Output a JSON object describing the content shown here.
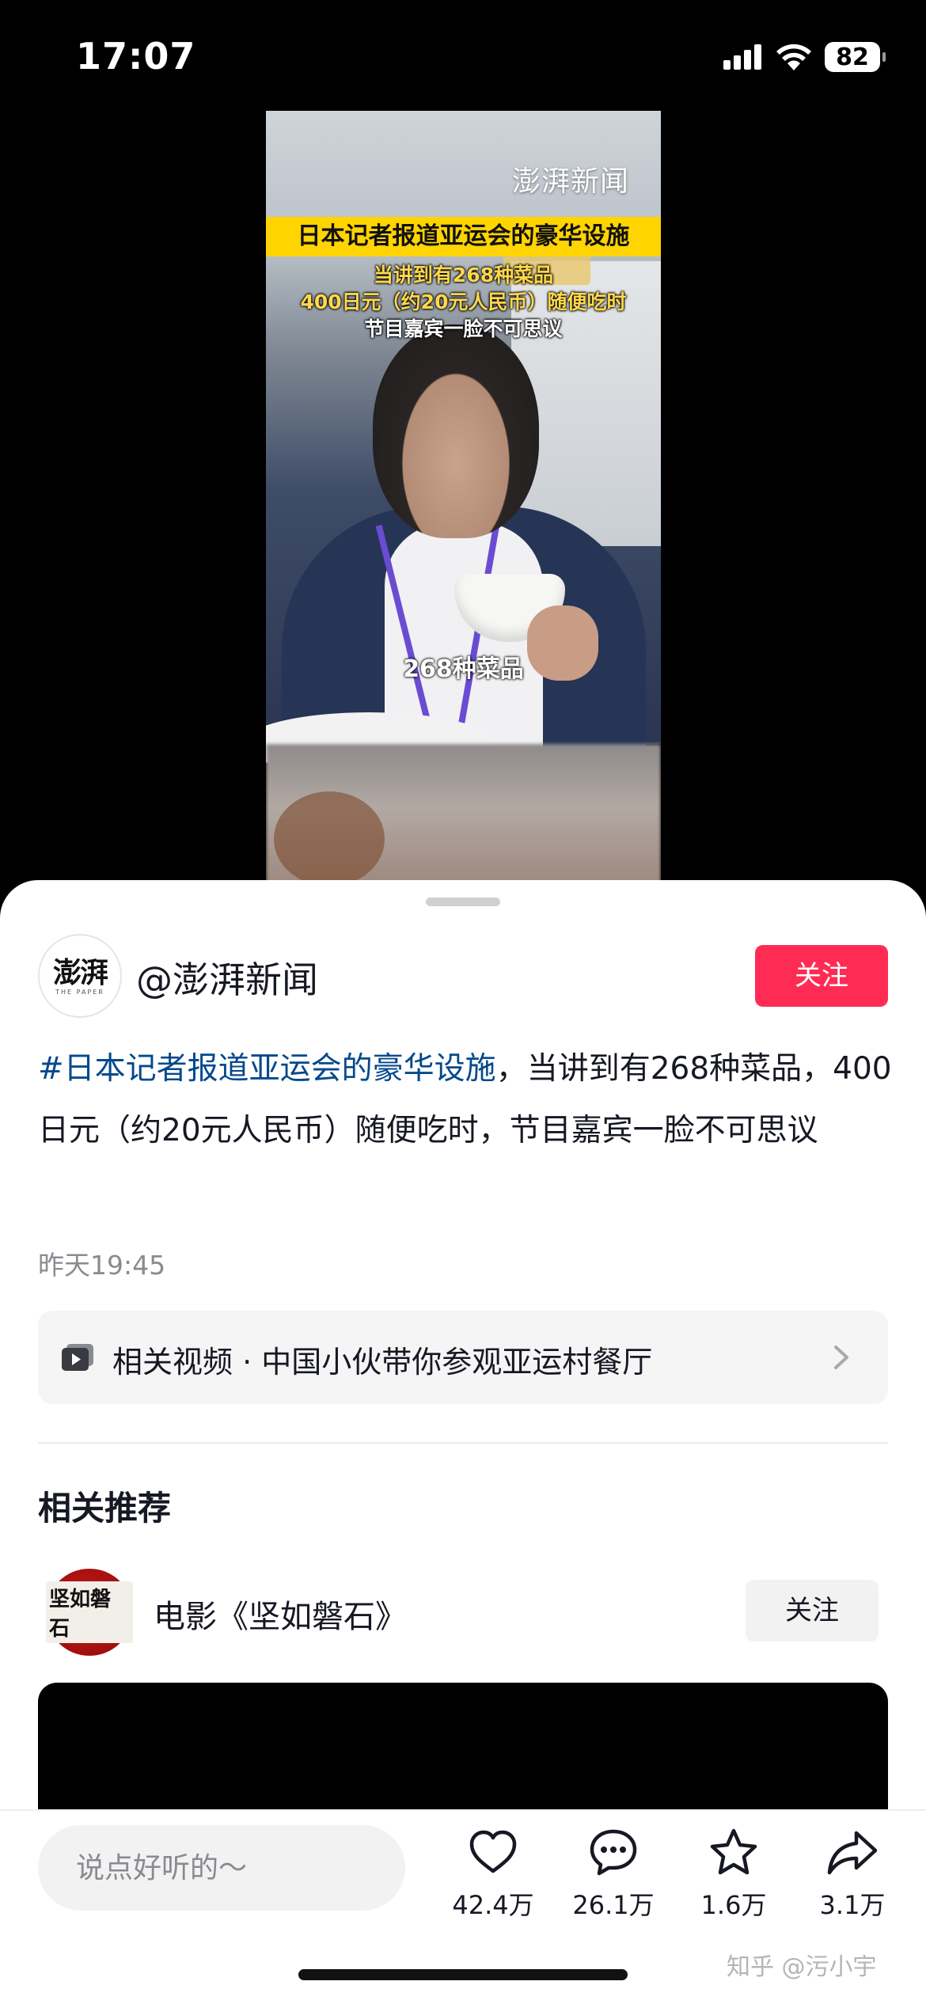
{
  "status_bar": {
    "time": "17:07",
    "battery": "82"
  },
  "video": {
    "logo": "澎湃新闻",
    "title_banner": "日本记者报道亚运会的豪华设施",
    "caption_lines": [
      "当讲到有268种菜品",
      "400日元（约20元人民币）随便吃时",
      "节目嘉宾一脸不可思议"
    ],
    "subtitle": "268种菜品"
  },
  "author": {
    "avatar_text": "澎湃",
    "avatar_subtext": "THE PAPER",
    "name": "@澎湃新闻",
    "follow_label": "关注"
  },
  "post": {
    "hashtag": "#日本记者报道亚运会的豪华设施",
    "description": "，当讲到有268种菜品，400日元（约20元人民币）随便吃时，节目嘉宾一脸不可思议",
    "time": "昨天19:45"
  },
  "related_video": {
    "text": "相关视频 · 中国小伙带你参观亚运村餐厅"
  },
  "recommendations": {
    "title": "相关推荐",
    "item": {
      "avatar_text": "坚如磐石",
      "name": "电影《坚如磐石》",
      "follow_label": "关注"
    }
  },
  "bottom_bar": {
    "comment_placeholder": "说点好听的～",
    "actions": {
      "like_count": "42.4万",
      "comment_count": "26.1万",
      "favorite_count": "1.6万",
      "share_count": "3.1万"
    },
    "watermark": "知乎 @污小宇"
  },
  "colors": {
    "follow_primary": "#fe2c55",
    "hashtag": "#04498d",
    "caption_banner": "#ffd400"
  },
  "icons": [
    "signal-icon",
    "wifi-icon",
    "battery-icon",
    "video-icon",
    "chevron-right-icon",
    "heart-icon",
    "comment-icon",
    "star-icon",
    "share-icon"
  ]
}
